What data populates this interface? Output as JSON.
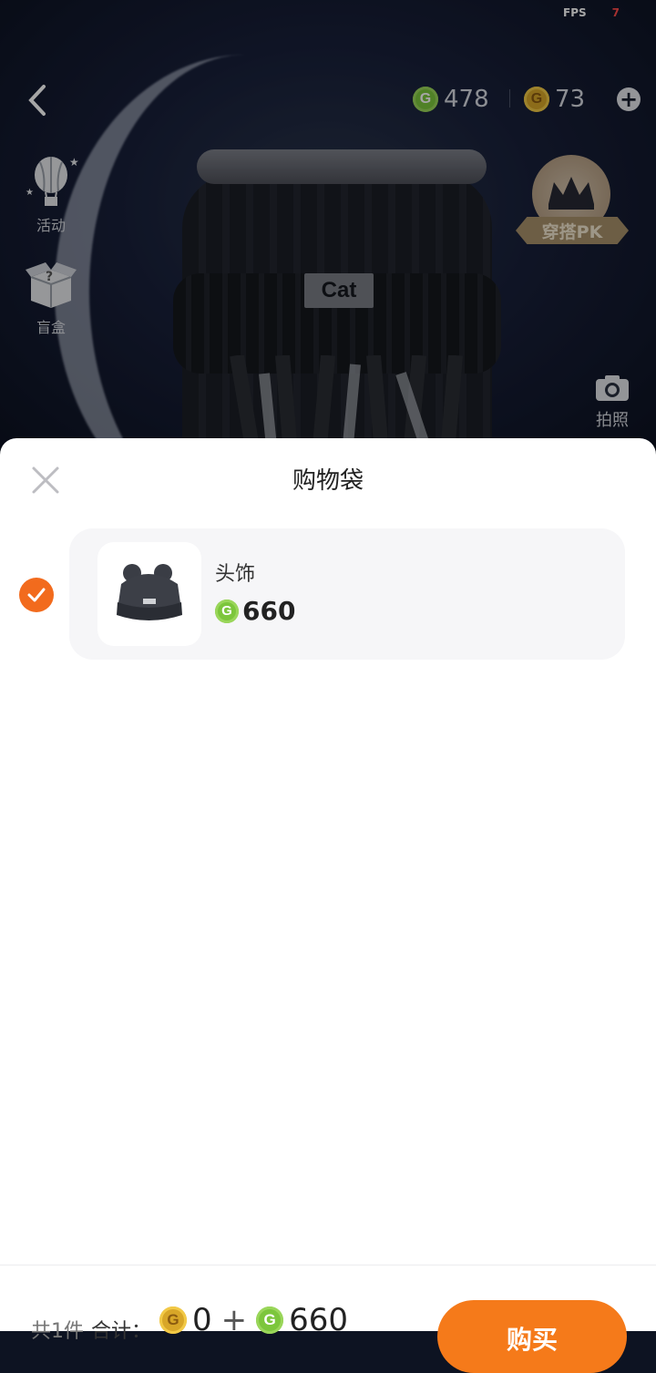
{
  "status": {
    "fps_label": "FPS",
    "fps_value": "7"
  },
  "header": {
    "green_coins": "478",
    "gold_coins": "73",
    "green_coin_symbol": "G",
    "gold_coin_symbol": "G"
  },
  "side": {
    "activity_label": "活动",
    "blindbox_label": "盲盒",
    "pk_label": "穿搭PK",
    "camera_label": "拍照"
  },
  "avatar": {
    "hat_tag": "Cat"
  },
  "sheet": {
    "title": "购物袋",
    "items": [
      {
        "name": "头饰",
        "price": "660",
        "selected": true
      }
    ]
  },
  "footer": {
    "count": "共1件",
    "total_label": "合计：",
    "gold_total": "0",
    "plus": "+",
    "green_total": "660",
    "buy_label": "购买"
  },
  "colors": {
    "accent": "#f26b1d",
    "green_coin": "#7cc63c",
    "gold_coin": "#d8a628"
  }
}
